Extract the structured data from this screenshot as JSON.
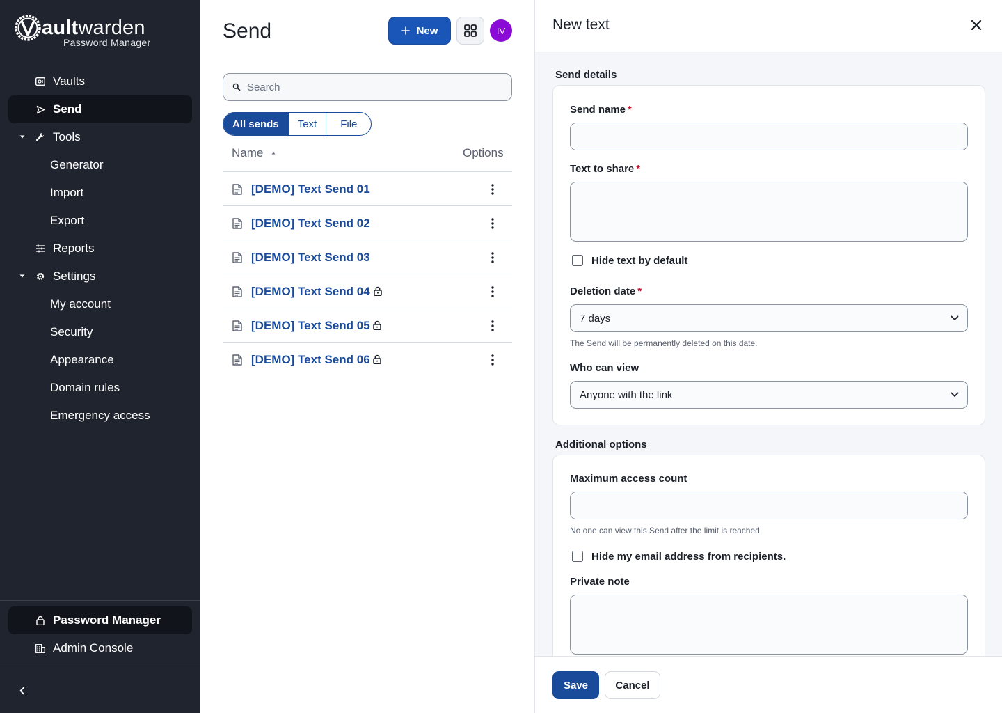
{
  "brand": {
    "word_bold": "ault",
    "word_rest": "warden",
    "subtitle": "Password Manager",
    "accent": "#1a4a9a"
  },
  "sidebar": {
    "items": [
      {
        "label": "Vaults",
        "icon": "vault-icon"
      },
      {
        "label": "Send",
        "icon": "send-icon",
        "active": true
      },
      {
        "label": "Tools",
        "icon": "wrench-icon",
        "expanded": true
      },
      {
        "label": "Generator"
      },
      {
        "label": "Import"
      },
      {
        "label": "Export"
      },
      {
        "label": "Reports",
        "icon": "sliders-icon"
      },
      {
        "label": "Settings",
        "icon": "gear-icon",
        "expanded": true
      },
      {
        "label": "My account"
      },
      {
        "label": "Security"
      },
      {
        "label": "Appearance"
      },
      {
        "label": "Domain rules"
      },
      {
        "label": "Emergency access"
      }
    ],
    "product_switcher": [
      {
        "label": "Password Manager",
        "icon": "lock-icon",
        "active": true
      },
      {
        "label": "Admin Console",
        "icon": "building-icon"
      }
    ],
    "collapse_icon": "chevron-left-icon"
  },
  "main": {
    "title": "Send",
    "new_button": "New",
    "avatar_initials": "IV",
    "search_placeholder": "Search",
    "filters": [
      "All sends",
      "Text",
      "File"
    ],
    "active_filter": "All sends",
    "columns": {
      "name": "Name",
      "options": "Options"
    },
    "rows": [
      {
        "name": "[DEMO] Text Send 01",
        "locked": false
      },
      {
        "name": "[DEMO] Text Send 02",
        "locked": false
      },
      {
        "name": "[DEMO] Text Send 03",
        "locked": false
      },
      {
        "name": "[DEMO] Text Send 04",
        "locked": true
      },
      {
        "name": "[DEMO] Text Send 05",
        "locked": true
      },
      {
        "name": "[DEMO] Text Send 06",
        "locked": true
      }
    ]
  },
  "drawer": {
    "title": "New text",
    "send_details_label": "Send details",
    "send_name_label": "Send name",
    "text_to_share_label": "Text to share",
    "hide_text_label": "Hide text by default",
    "deletion_date_label": "Deletion date",
    "deletion_date_value": "7 days",
    "deletion_hint": "The Send will be permanently deleted on this date.",
    "who_can_view_label": "Who can view",
    "who_can_view_value": "Anyone with the link",
    "additional_options_label": "Additional options",
    "max_access_label": "Maximum access count",
    "max_access_hint": "No one can view this Send after the limit is reached.",
    "hide_email_label": "Hide my email address from recipients.",
    "private_note_label": "Private note",
    "save_button": "Save",
    "cancel_button": "Cancel"
  }
}
